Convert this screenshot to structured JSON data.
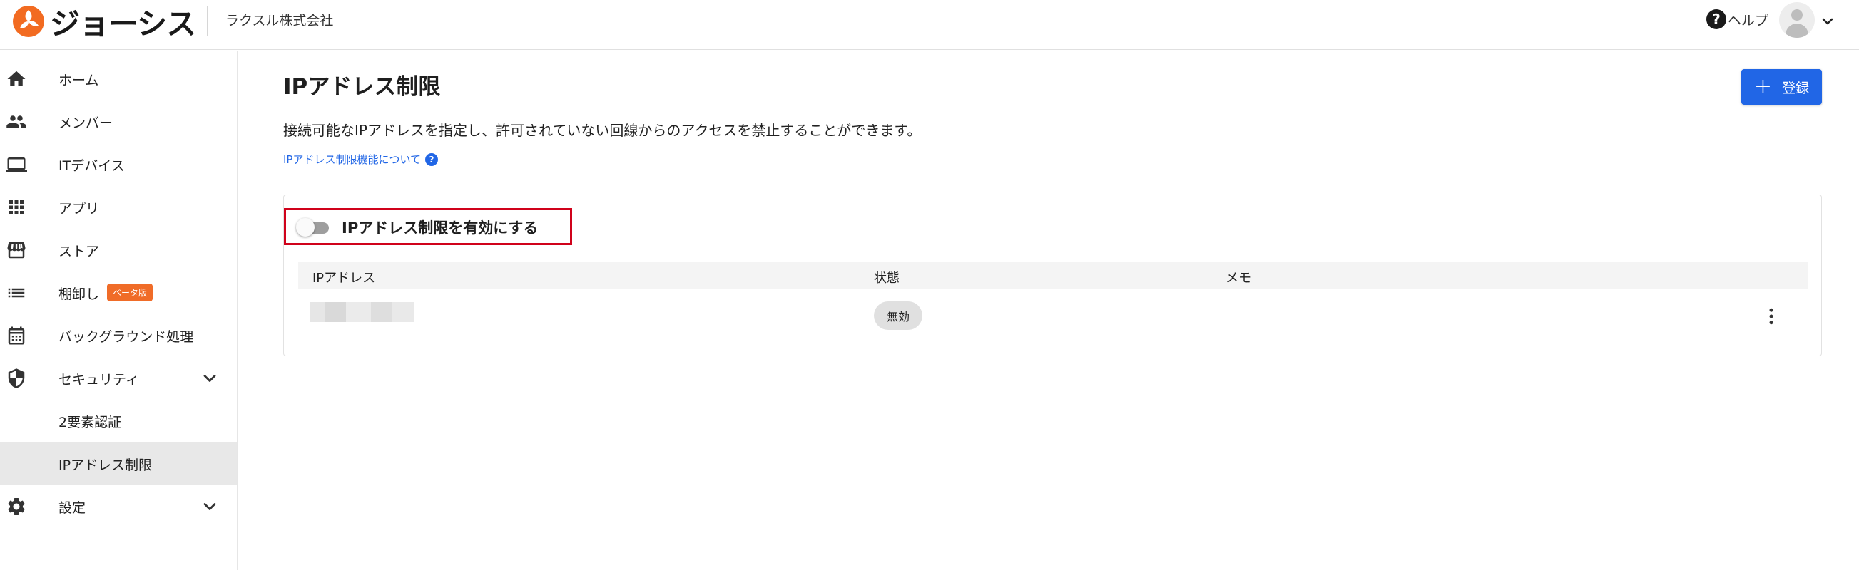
{
  "header": {
    "logo_text": "ジョーシス",
    "company": "ラクスル株式会社",
    "help_label": "ヘルプ",
    "help_icon": "?"
  },
  "sidebar": {
    "items": [
      {
        "label": "ホーム",
        "icon": "home-icon"
      },
      {
        "label": "メンバー",
        "icon": "people-icon"
      },
      {
        "label": "ITデバイス",
        "icon": "laptop-icon"
      },
      {
        "label": "アプリ",
        "icon": "apps-grid-icon"
      },
      {
        "label": "ストア",
        "icon": "store-icon"
      },
      {
        "label": "棚卸し",
        "icon": "list-icon",
        "badge": "ベータ版"
      },
      {
        "label": "バックグラウンド処理",
        "icon": "calendar-icon"
      },
      {
        "label": "セキュリティ",
        "icon": "shield-icon"
      },
      {
        "label": "2要素認証"
      },
      {
        "label": "IPアドレス制限",
        "active": true
      },
      {
        "label": "設定",
        "icon": "gear-icon"
      }
    ]
  },
  "main": {
    "title": "IPアドレス制限",
    "add_button": "登録",
    "description": "接続可能なIPアドレスを指定し、許可されていない回線からのアクセスを禁止することができます。",
    "info_link": "IPアドレス制限機能について",
    "toggle_label": "IPアドレス制限を有効にする",
    "toggle_on": false,
    "table": {
      "columns": [
        "IPアドレス",
        "状態",
        "メモ"
      ],
      "rows": [
        {
          "ip": "",
          "status": "無効",
          "memo": ""
        }
      ]
    }
  },
  "colors": {
    "primary": "#2166e6",
    "beta_badge": "#f06c28",
    "highlight_border": "#d0021b",
    "logo_orange": "#f26b21"
  }
}
